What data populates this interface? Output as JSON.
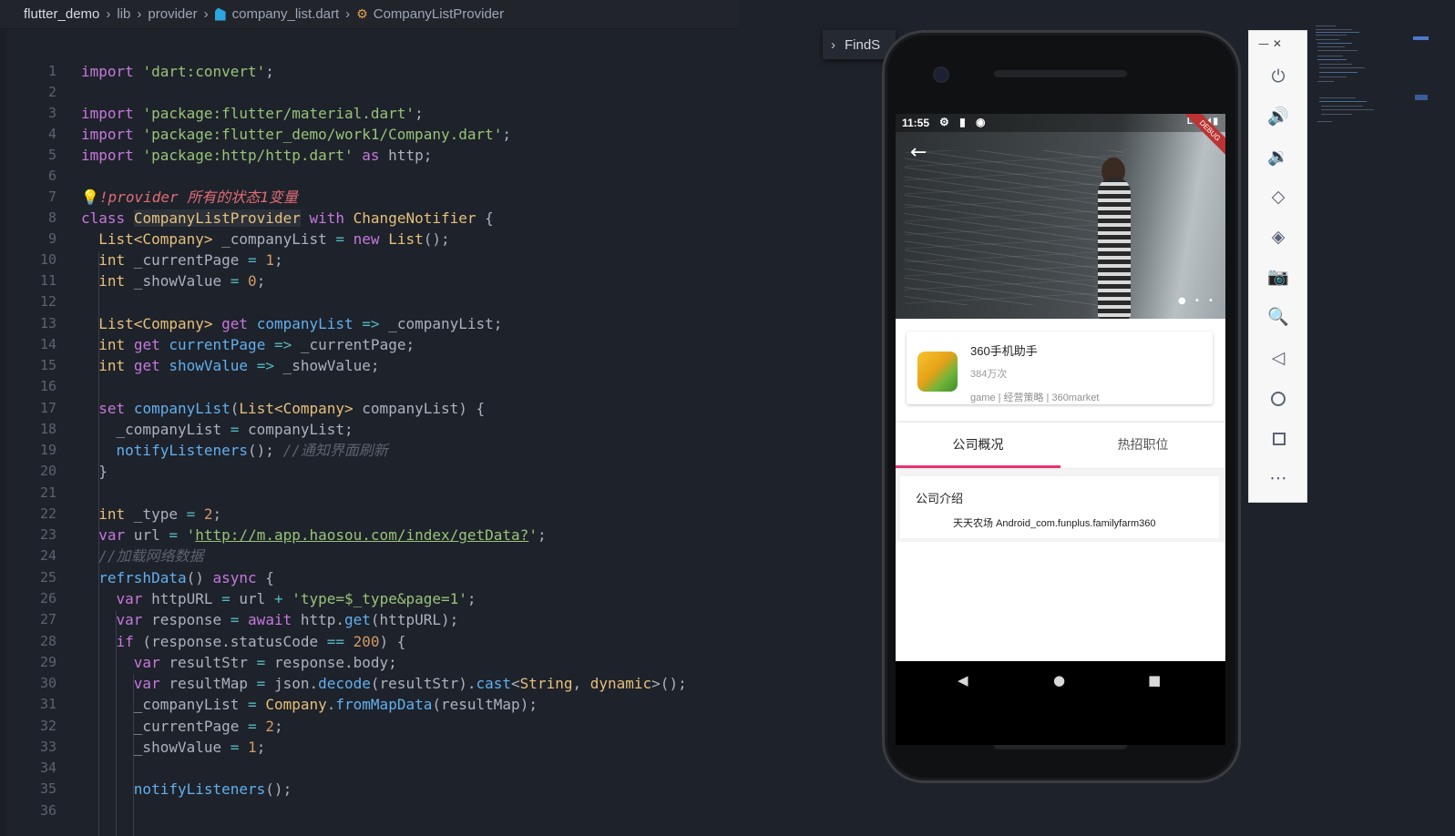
{
  "breadcrumb": {
    "root": "flutter_demo",
    "parts": [
      "lib",
      "provider"
    ],
    "file": "company_list.dart",
    "symbol": "CompanyListProvider"
  },
  "find_widget": {
    "label": "FindS"
  },
  "code": {
    "line_numbers": [
      "1",
      "2",
      "3",
      "4",
      "5",
      "6",
      "7",
      "8",
      "9",
      "10",
      "11",
      "12",
      "13",
      "14",
      "15",
      "16",
      "17",
      "18",
      "19",
      "20",
      "21",
      "22",
      "23",
      "24",
      "25",
      "26",
      "27",
      "28",
      "29",
      "30",
      "31",
      "32",
      "33",
      "34",
      "35",
      "36"
    ],
    "tokens": {
      "import": "import",
      "dart_convert": "'dart:convert'",
      "pkg_material": "'package:flutter/material.dart'",
      "pkg_company": "'package:flutter_demo/work1/Company.dart'",
      "pkg_http": "'package:http/http.dart'",
      "as": "as",
      "http": "http",
      "semi": ";",
      "lightbulb": "💡",
      "warning_comment": "!provider 所有的状态1变量",
      "class": "class",
      "class_name": "CompanyListProvider",
      "with": "with",
      "mixin": "ChangeNotifier",
      "brace_open": " {",
      "list_company": "List<Company>",
      "company_list_field": " _companyList ",
      "eq": "=",
      "new": "new",
      "list_ctor": "List",
      "parens_semi": "();",
      "int": "int",
      "current_page_field": " _currentPage ",
      "show_value_field": " _showValue ",
      "one": "1",
      "zero": "0",
      "two": "2",
      "n200": "200",
      "get": "get",
      "company_list_getter": "companyList",
      "current_page_getter": "currentPage",
      "show_value_getter": "showValue",
      "arrow": "=>",
      "ret_company_list": " _companyList;",
      "ret_current_page": " _currentPage;",
      "ret_show_value": " _showValue;",
      "set": "set",
      "set_name": "companyList",
      "param": " companyList) {",
      "paren_open": "(",
      "assign_company_list": "_companyList ",
      "company_list_semi": " companyList;",
      "notify": "notifyListeners",
      "notify_tail": "(); ",
      "comment_refresh": "//通知界面刷新",
      "brace_close": "}",
      "type_field": " _type ",
      "var": "var",
      "url_var": " url ",
      "quote": "'",
      "url_value": "http://m.app.haosou.com/index/getData?",
      "quote_semi": "';",
      "comment_load": "//加载网络数据",
      "refresh_name": "refrshData",
      "async_open": "() ",
      "async": "async",
      "http_url_var": " httpURL ",
      "url_plus": " url ",
      "plus": "+",
      "type_page_str": "'type=$_type&page=1'",
      "response_var": " response ",
      "await": "await",
      "http_get": " http.",
      "get_call": "get",
      "http_url_arg": "(httpURL);",
      "if": "if",
      "status_check": " (response.statusCode ",
      "eqeq": "==",
      "paren_close_brace": ") {",
      "result_str_var": " resultStr ",
      "response_body": " response.body;",
      "result_map_var": " resultMap ",
      "json_decode": " json.",
      "decode": "decode",
      "decode_arg": "(resultStr).",
      "cast": "cast",
      "lt": "<",
      "string_type": "String",
      "comma": ", ",
      "dynamic": "dynamic",
      "gt_call": ">();",
      "company_class": "Company",
      "dot": ".",
      "from_map": "fromMapData",
      "from_map_arg": "(resultMap);",
      "current_page_assign": "_currentPage ",
      "show_value_assign": "_showValue ",
      "notify_call_end": "();"
    }
  },
  "phone": {
    "status_time": "11:55",
    "status_icons": "⚙ ▮ ◉",
    "status_right": "LTE◢ ▮",
    "debug_ribbon": "DEBUG",
    "back_icon": "arrow-left",
    "app": {
      "name": "360手机助手",
      "count": "384万次",
      "tags": "game | 经营策略 | 360market"
    },
    "tabs": [
      "公司概况",
      "热招职位"
    ],
    "intro_title": "公司介绍",
    "intro_text": "天天农场 Android_com.funplus.familyfarm360",
    "nav_buttons": [
      "◀",
      "●",
      "■"
    ]
  },
  "emulator_toolbar": {
    "window_controls": "—  ✕",
    "buttons": [
      "power-icon",
      "volume-up-icon",
      "volume-down-icon",
      "rotate-left-icon",
      "rotate-right-icon",
      "camera-icon",
      "zoom-icon",
      "back-icon",
      "home-icon",
      "overview-icon",
      "more-icon"
    ]
  },
  "colors": {
    "editor_bg": "#1e222a",
    "keyword": "#c678dd",
    "string": "#98c379",
    "type": "#e5c07b",
    "number": "#d19a66",
    "function": "#61afef",
    "accent_tab": "#e8336f"
  }
}
